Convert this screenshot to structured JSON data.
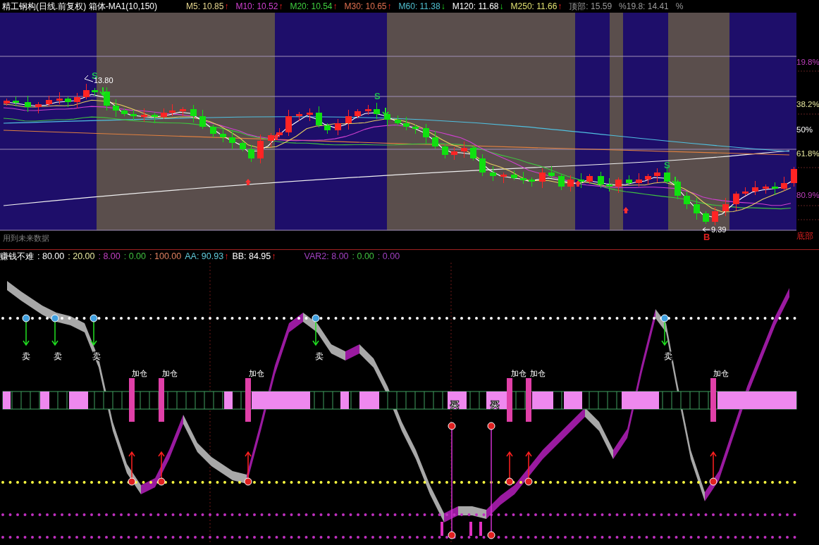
{
  "header": {
    "title": "精工钢构(日线.前复权) 箱体-MA1(10,150)",
    "averages": [
      {
        "label": "M5: 10.85",
        "arrow": "↑",
        "rising": true,
        "color": "#e8d890"
      },
      {
        "label": "M10: 10.52",
        "arrow": "↑",
        "rising": true,
        "color": "#d040d0"
      },
      {
        "label": "M20: 10.54",
        "arrow": "↑",
        "rising": true,
        "color": "#40d040"
      },
      {
        "label": "M30: 10.65",
        "arrow": "↑",
        "rising": true,
        "color": "#e07050"
      },
      {
        "label": "M60: 11.38",
        "arrow": "↓",
        "rising": false,
        "color": "#50c0d0"
      },
      {
        "label": "M120: 11.68",
        "arrow": "↓",
        "rising": false,
        "color": "#ffffff"
      },
      {
        "label": "M250: 11.66",
        "arrow": "↑",
        "rising": true,
        "color": "#e0e070"
      }
    ],
    "top_label": "顶部: 15.59",
    "level_label": "%19.8: 14.41",
    "percent": "%"
  },
  "price_chart": {
    "levels": [
      {
        "label": "19.8%",
        "color": "#c040c0"
      },
      {
        "label": "38.2%",
        "color": "#e8e8a0"
      },
      {
        "label": "50%",
        "color": "#ffffff"
      },
      {
        "label": "61.8%",
        "color": "#e8e8a0"
      },
      {
        "label": "80.9%",
        "color": "#c040c0"
      }
    ],
    "bottom_label": "底部",
    "signals": [
      {
        "kind": "sell",
        "label": "S"
      },
      {
        "kind": "sell",
        "label": "S"
      },
      {
        "kind": "sell",
        "label": "S"
      },
      {
        "kind": "buy",
        "label": "B"
      }
    ],
    "high_price": "13.80",
    "low_price": "9.39"
  },
  "note": "用到未来数据",
  "indicator": {
    "name": "赚钱不难",
    "values": [
      {
        "label": ": 80.00",
        "color": "#ffffff"
      },
      {
        "label": ": 20.00",
        "color": "#e8e8a0"
      },
      {
        "label": ": 8.00",
        "color": "#c040c0"
      },
      {
        "label": ": 0.00",
        "color": "#40c040"
      },
      {
        "label": ": 100.00",
        "color": "#e08060"
      },
      {
        "label": "AA: 90.93",
        "color": "#60c8d8",
        "arrow": "↑",
        "rising": true
      },
      {
        "label": "BB: 84.95",
        "color": "#ffffff",
        "arrow": "↑",
        "rising": true
      },
      {
        "label": "VAR2: 8.00",
        "color": "#a040c0"
      },
      {
        "label": ": 0.00",
        "color": "#40c040"
      },
      {
        "label": ": 0.00",
        "color": "#a040c0"
      }
    ],
    "sell_labels": [
      "卖",
      "卖",
      "卖",
      "卖",
      "卖"
    ],
    "add_labels": [
      "加仓",
      "加仓",
      "加仓",
      "加仓",
      "加仓",
      "加仓"
    ],
    "buy_labels": [
      "买",
      "买"
    ]
  }
}
